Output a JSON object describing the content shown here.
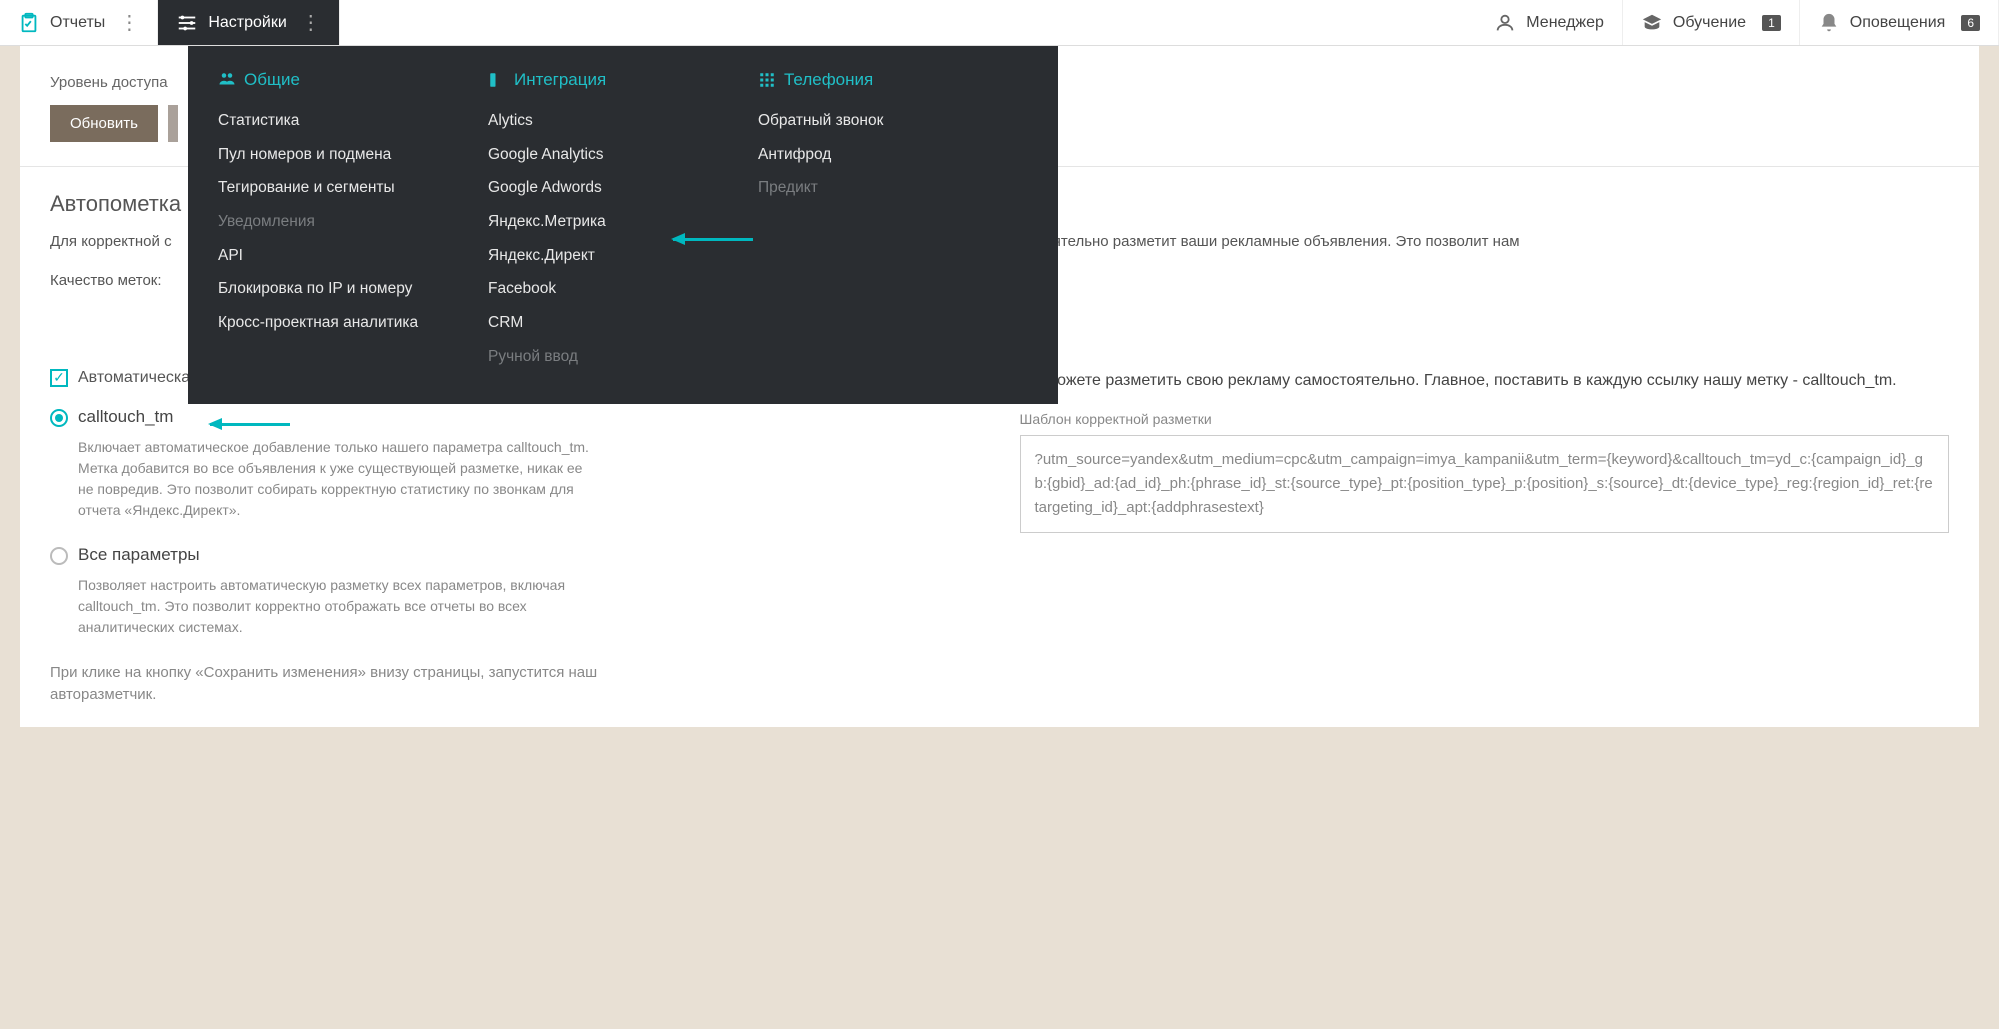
{
  "topbar": {
    "reports": "Отчеты",
    "settings": "Настройки",
    "manager": "Менеджер",
    "training": "Обучение",
    "training_badge": "1",
    "notifications": "Оповещения",
    "notifications_badge": "6"
  },
  "dropdown": {
    "col1": {
      "title": "Общие",
      "items": [
        "Статистика",
        "Пул номеров и подмена",
        "Тегирование и сегменты",
        "Уведомления",
        "API",
        "Блокировка по IP и номеру",
        "Кросс-проектная аналитика"
      ],
      "disabled_idx": 3
    },
    "col2": {
      "title": "Интеграция",
      "items": [
        "Alytics",
        "Google Analytics",
        "Google Adwords",
        "Яндекс.Метрика",
        "Яндекс.Директ",
        "Facebook",
        "CRM",
        "Ручной ввод"
      ],
      "disabled_idx": 7
    },
    "col3": {
      "title": "Телефония",
      "items": [
        "Обратный звонок",
        "Антифрод",
        "Предикт"
      ],
      "disabled_idx": 2
    }
  },
  "page": {
    "access_label": "Уровень доступа",
    "update_btn": "Обновить",
    "section_title": "Автопометка",
    "desc_prefix": "Для корректной с",
    "desc_suffix": "мостоятельно разметит ваши рекламные объявления. Это позволит нам",
    "quality_label": "Качество меток:",
    "checkbox_label": "Автоматическая разметка",
    "radio1": {
      "label": "calltouch_tm",
      "desc": "Включает автоматическое добавление только нашего параметра calltouch_tm. Метка добавится во все объявления к уже существующей разметке, никак ее не повредив. Это позволит собирать корректную статистику по звонкам для отчета «Яндекс.Директ»."
    },
    "radio2": {
      "label": "Все параметры",
      "desc": "Позволяет настроить автоматическую разметку всех параметров, включая calltouch_tm. Это позволит корректно отображать все отчеты во всех аналитических системах."
    },
    "note": "При клике на кнопку «Сохранить изменения» внизу страницы, запустится наш авторазметчик.",
    "right_desc": "Вы можете разметить свою рекламу самостоятельно. Главное, поставить в каждую ссылку нашу метку - calltouch_tm.",
    "template_label": "Шаблон корректной разметки",
    "template_text": "?utm_source=yandex&utm_medium=cpc&utm_campaign=imya_kampanii&utm_term={keyword}&calltouch_tm=yd_c:{campaign_id}_gb:{gbid}_ad:{ad_id}_ph:{phrase_id}_st:{source_type}_pt:{position_type}_p:{position}_s:{source}_dt:{device_type}_reg:{region_id}_ret:{retargeting_id}_apt:{addphrasestext}"
  }
}
